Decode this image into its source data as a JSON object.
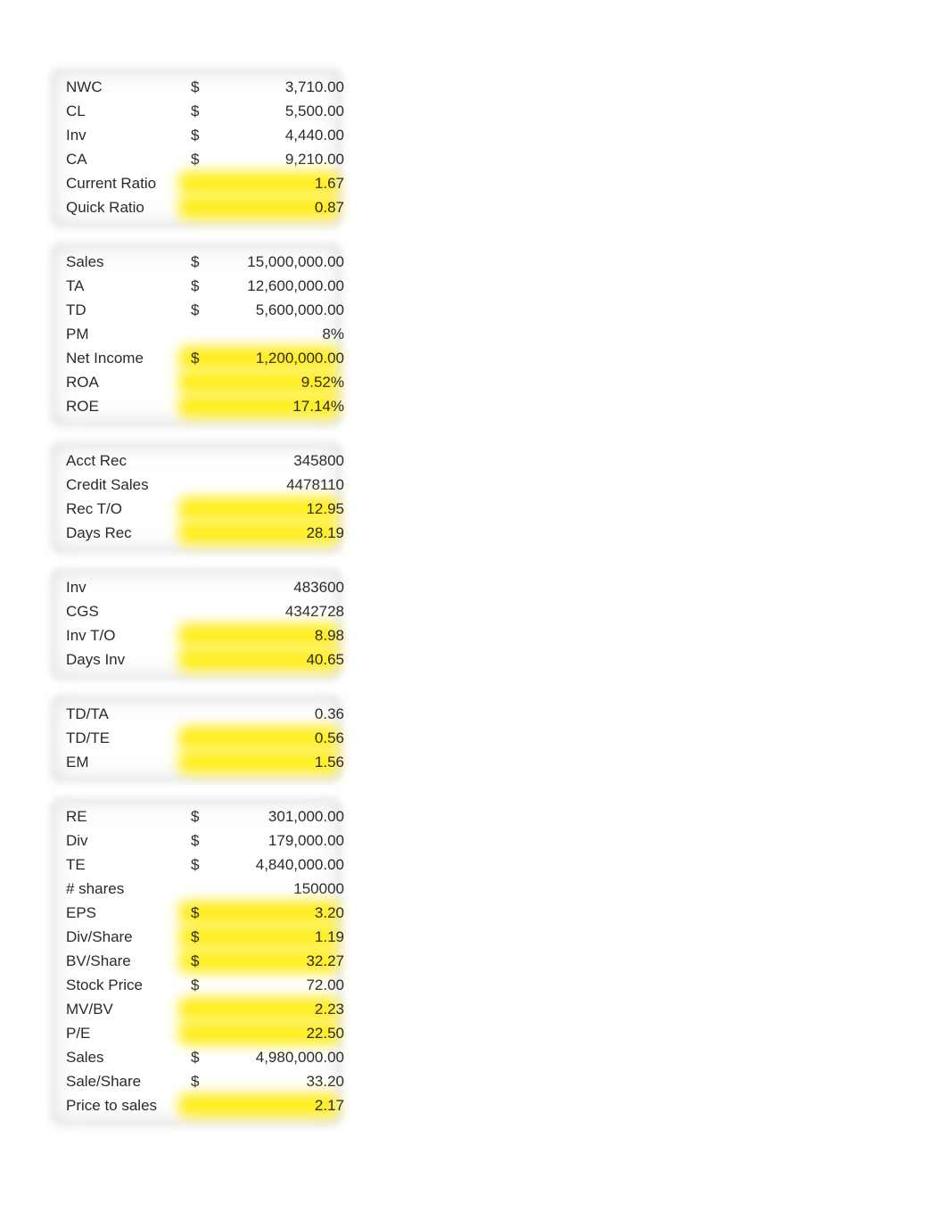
{
  "blocks": [
    {
      "rows": [
        {
          "label": "NWC",
          "sym": "$",
          "value": "3,710.00",
          "highlight": false
        },
        {
          "label": "CL",
          "sym": "$",
          "value": "5,500.00",
          "highlight": false
        },
        {
          "label": "Inv",
          "sym": "$",
          "value": "4,440.00",
          "highlight": false
        },
        {
          "label": "CA",
          "sym": "$",
          "value": "9,210.00",
          "highlight": false
        },
        {
          "label": "Current Ratio",
          "sym": "",
          "value": "1.67",
          "highlight": true
        },
        {
          "label": "Quick Ratio",
          "sym": "",
          "value": "0.87",
          "highlight": true
        }
      ]
    },
    {
      "rows": [
        {
          "label": "Sales",
          "sym": "$",
          "value": "15,000,000.00",
          "highlight": false
        },
        {
          "label": "TA",
          "sym": "$",
          "value": "12,600,000.00",
          "highlight": false
        },
        {
          "label": "TD",
          "sym": "$",
          "value": "5,600,000.00",
          "highlight": false
        },
        {
          "label": "PM",
          "sym": "",
          "value": "8%",
          "highlight": false
        },
        {
          "label": "Net Income",
          "sym": "$",
          "value": "1,200,000.00",
          "highlight": true
        },
        {
          "label": "ROA",
          "sym": "",
          "value": "9.52%",
          "highlight": true
        },
        {
          "label": "ROE",
          "sym": "",
          "value": "17.14%",
          "highlight": true
        }
      ]
    },
    {
      "rows": [
        {
          "label": "Acct Rec",
          "sym": "",
          "value": "345800",
          "highlight": false
        },
        {
          "label": "Credit Sales",
          "sym": "",
          "value": "4478110",
          "highlight": false
        },
        {
          "label": "Rec T/O",
          "sym": "",
          "value": "12.95",
          "highlight": true
        },
        {
          "label": "Days Rec",
          "sym": "",
          "value": "28.19",
          "highlight": true
        }
      ]
    },
    {
      "rows": [
        {
          "label": "Inv",
          "sym": "",
          "value": "483600",
          "highlight": false
        },
        {
          "label": "CGS",
          "sym": "",
          "value": "4342728",
          "highlight": false
        },
        {
          "label": "Inv T/O",
          "sym": "",
          "value": "8.98",
          "highlight": true
        },
        {
          "label": "Days Inv",
          "sym": "",
          "value": "40.65",
          "highlight": true
        }
      ]
    },
    {
      "rows": [
        {
          "label": "TD/TA",
          "sym": "",
          "value": "0.36",
          "highlight": false
        },
        {
          "label": "TD/TE",
          "sym": "",
          "value": "0.56",
          "highlight": true
        },
        {
          "label": "EM",
          "sym": "",
          "value": "1.56",
          "highlight": true
        }
      ]
    },
    {
      "rows": [
        {
          "label": "RE",
          "sym": "$",
          "value": "301,000.00",
          "highlight": false
        },
        {
          "label": "Div",
          "sym": "$",
          "value": "179,000.00",
          "highlight": false
        },
        {
          "label": "TE",
          "sym": "$",
          "value": "4,840,000.00",
          "highlight": false
        },
        {
          "label": "# shares",
          "sym": "",
          "value": "150000",
          "highlight": false
        },
        {
          "label": "EPS",
          "sym": "$",
          "value": "3.20",
          "highlight": true
        },
        {
          "label": "Div/Share",
          "sym": "$",
          "value": "1.19",
          "highlight": true
        },
        {
          "label": "BV/Share",
          "sym": "$",
          "value": "32.27",
          "highlight": true
        },
        {
          "label": "Stock Price",
          "sym": "$",
          "value": "72.00",
          "highlight": false
        },
        {
          "label": "MV/BV",
          "sym": "",
          "value": "2.23",
          "highlight": true
        },
        {
          "label": "P/E",
          "sym": "",
          "value": "22.50",
          "highlight": true
        },
        {
          "label": "Sales",
          "sym": "$",
          "value": "4,980,000.00",
          "highlight": false
        },
        {
          "label": "Sale/Share",
          "sym": "$",
          "value": "33.20",
          "highlight": false
        },
        {
          "label": "Price to sales",
          "sym": "",
          "value": "2.17",
          "highlight": true
        }
      ]
    }
  ]
}
